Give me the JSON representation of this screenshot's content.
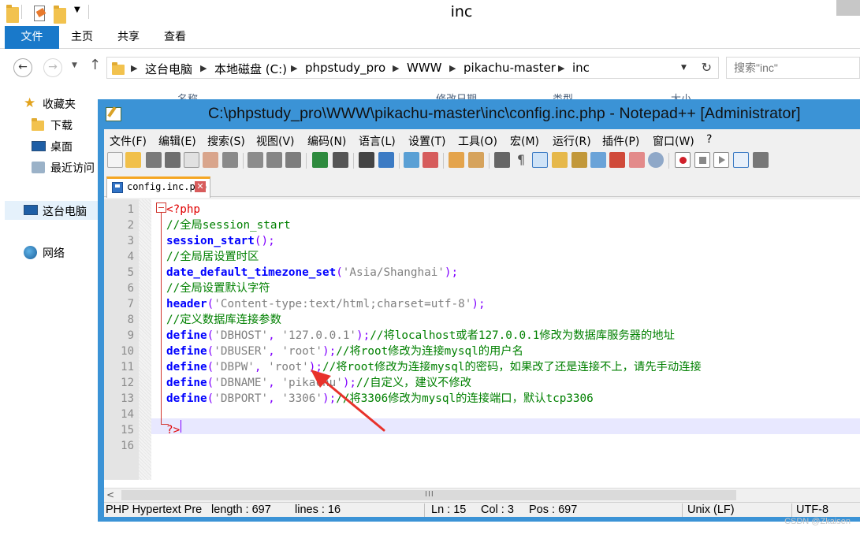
{
  "explorer": {
    "title": "inc",
    "ribbon_tabs": [
      "文件",
      "主页",
      "共享",
      "查看"
    ],
    "breadcrumbs": [
      "这台电脑",
      "本地磁盘 (C:)",
      "phpstudy_pro",
      "WWW",
      "pikachu-master",
      "inc"
    ],
    "search_placeholder": "搜索\"inc\"",
    "nav_items": {
      "favorites": "收藏夹",
      "downloads": "下载",
      "desktop": "桌面",
      "recent": "最近访问",
      "this_pc": "这台电脑",
      "network": "网络"
    },
    "column_headers": [
      "名称",
      "修改日期",
      "类型",
      "大小"
    ]
  },
  "notepad": {
    "title": "C:\\phpstudy_pro\\WWW\\pikachu-master\\inc\\config.inc.php - Notepad++ [Administrator]",
    "menu": [
      "文件(F)",
      "编辑(E)",
      "搜索(S)",
      "视图(V)",
      "编码(N)",
      "语言(L)",
      "设置(T)",
      "工具(O)",
      "宏(M)",
      "运行(R)",
      "插件(P)",
      "窗口(W)",
      "?"
    ],
    "tab_filename": "config.inc.php",
    "code_lines": [
      {
        "n": "1",
        "segs": [
          [
            "tag",
            "<?php"
          ]
        ]
      },
      {
        "n": "2",
        "segs": [
          [
            "comment",
            "//全局session_start"
          ]
        ]
      },
      {
        "n": "3",
        "segs": [
          [
            "fn",
            "session_start"
          ],
          [
            "op",
            "();"
          ]
        ]
      },
      {
        "n": "4",
        "segs": [
          [
            "comment",
            "//全局居设置时区"
          ]
        ]
      },
      {
        "n": "5",
        "segs": [
          [
            "fn",
            "date_default_timezone_set"
          ],
          [
            "op",
            "("
          ],
          [
            "str",
            "'Asia/Shanghai'"
          ],
          [
            "op",
            ");"
          ]
        ]
      },
      {
        "n": "6",
        "segs": [
          [
            "comment",
            "//全局设置默认字符"
          ]
        ]
      },
      {
        "n": "7",
        "segs": [
          [
            "fn",
            "header"
          ],
          [
            "op",
            "("
          ],
          [
            "str",
            "'Content-type:text/html;charset=utf-8'"
          ],
          [
            "op",
            ");"
          ]
        ]
      },
      {
        "n": "8",
        "segs": [
          [
            "comment",
            "//定义数据库连接参数"
          ]
        ]
      },
      {
        "n": "9",
        "segs": [
          [
            "fn",
            "define"
          ],
          [
            "op",
            "("
          ],
          [
            "str",
            "'DBHOST'"
          ],
          [
            "op",
            ", "
          ],
          [
            "str",
            "'127.0.0.1'"
          ],
          [
            "op",
            ");"
          ],
          [
            "comment",
            "//将localhost或者127.0.0.1修改为数据库服务器的地址"
          ]
        ]
      },
      {
        "n": "10",
        "segs": [
          [
            "fn",
            "define"
          ],
          [
            "op",
            "("
          ],
          [
            "str",
            "'DBUSER'"
          ],
          [
            "op",
            ", "
          ],
          [
            "str",
            "'root'"
          ],
          [
            "op",
            ");"
          ],
          [
            "comment",
            "//将root修改为连接mysql的用户名"
          ]
        ]
      },
      {
        "n": "11",
        "segs": [
          [
            "fn",
            "define"
          ],
          [
            "op",
            "("
          ],
          [
            "str",
            "'DBPW'"
          ],
          [
            "op",
            ", "
          ],
          [
            "str",
            "'root'"
          ],
          [
            "op",
            ");"
          ],
          [
            "comment",
            "//将root修改为连接mysql的密码，如果改了还是连接不上，请先手动连接"
          ]
        ]
      },
      {
        "n": "12",
        "segs": [
          [
            "fn",
            "define"
          ],
          [
            "op",
            "("
          ],
          [
            "str",
            "'DBNAME'"
          ],
          [
            "op",
            ", "
          ],
          [
            "str",
            "'pikachu'"
          ],
          [
            "op",
            ");"
          ],
          [
            "comment",
            "//自定义，建议不修改"
          ]
        ]
      },
      {
        "n": "13",
        "segs": [
          [
            "fn",
            "define"
          ],
          [
            "op",
            "("
          ],
          [
            "str",
            "'DBPORT'"
          ],
          [
            "op",
            ", "
          ],
          [
            "str",
            "'3306'"
          ],
          [
            "op",
            ");"
          ],
          [
            "comment",
            "//将3306修改为mysql的连接端口，默认tcp3306"
          ]
        ]
      },
      {
        "n": "14",
        "segs": []
      },
      {
        "n": "15",
        "segs": [
          [
            "tag",
            "?>"
          ]
        ]
      },
      {
        "n": "16",
        "segs": []
      }
    ],
    "status": {
      "language": "PHP Hypertext Pre",
      "length": "length : 697",
      "lines": "lines : 16",
      "ln": "Ln : 15",
      "col": "Col : 3",
      "pos": "Pos : 697",
      "eol": "Unix (LF)",
      "encoding": "UTF-8"
    },
    "colors": {
      "tag": "#e00000",
      "comment": "#008000",
      "keyword": "#0000ff",
      "string": "#808080",
      "operator": "#8000ff",
      "annotation_arrow": "#e8322b"
    }
  },
  "watermark": "CSDN @Zkaisen"
}
